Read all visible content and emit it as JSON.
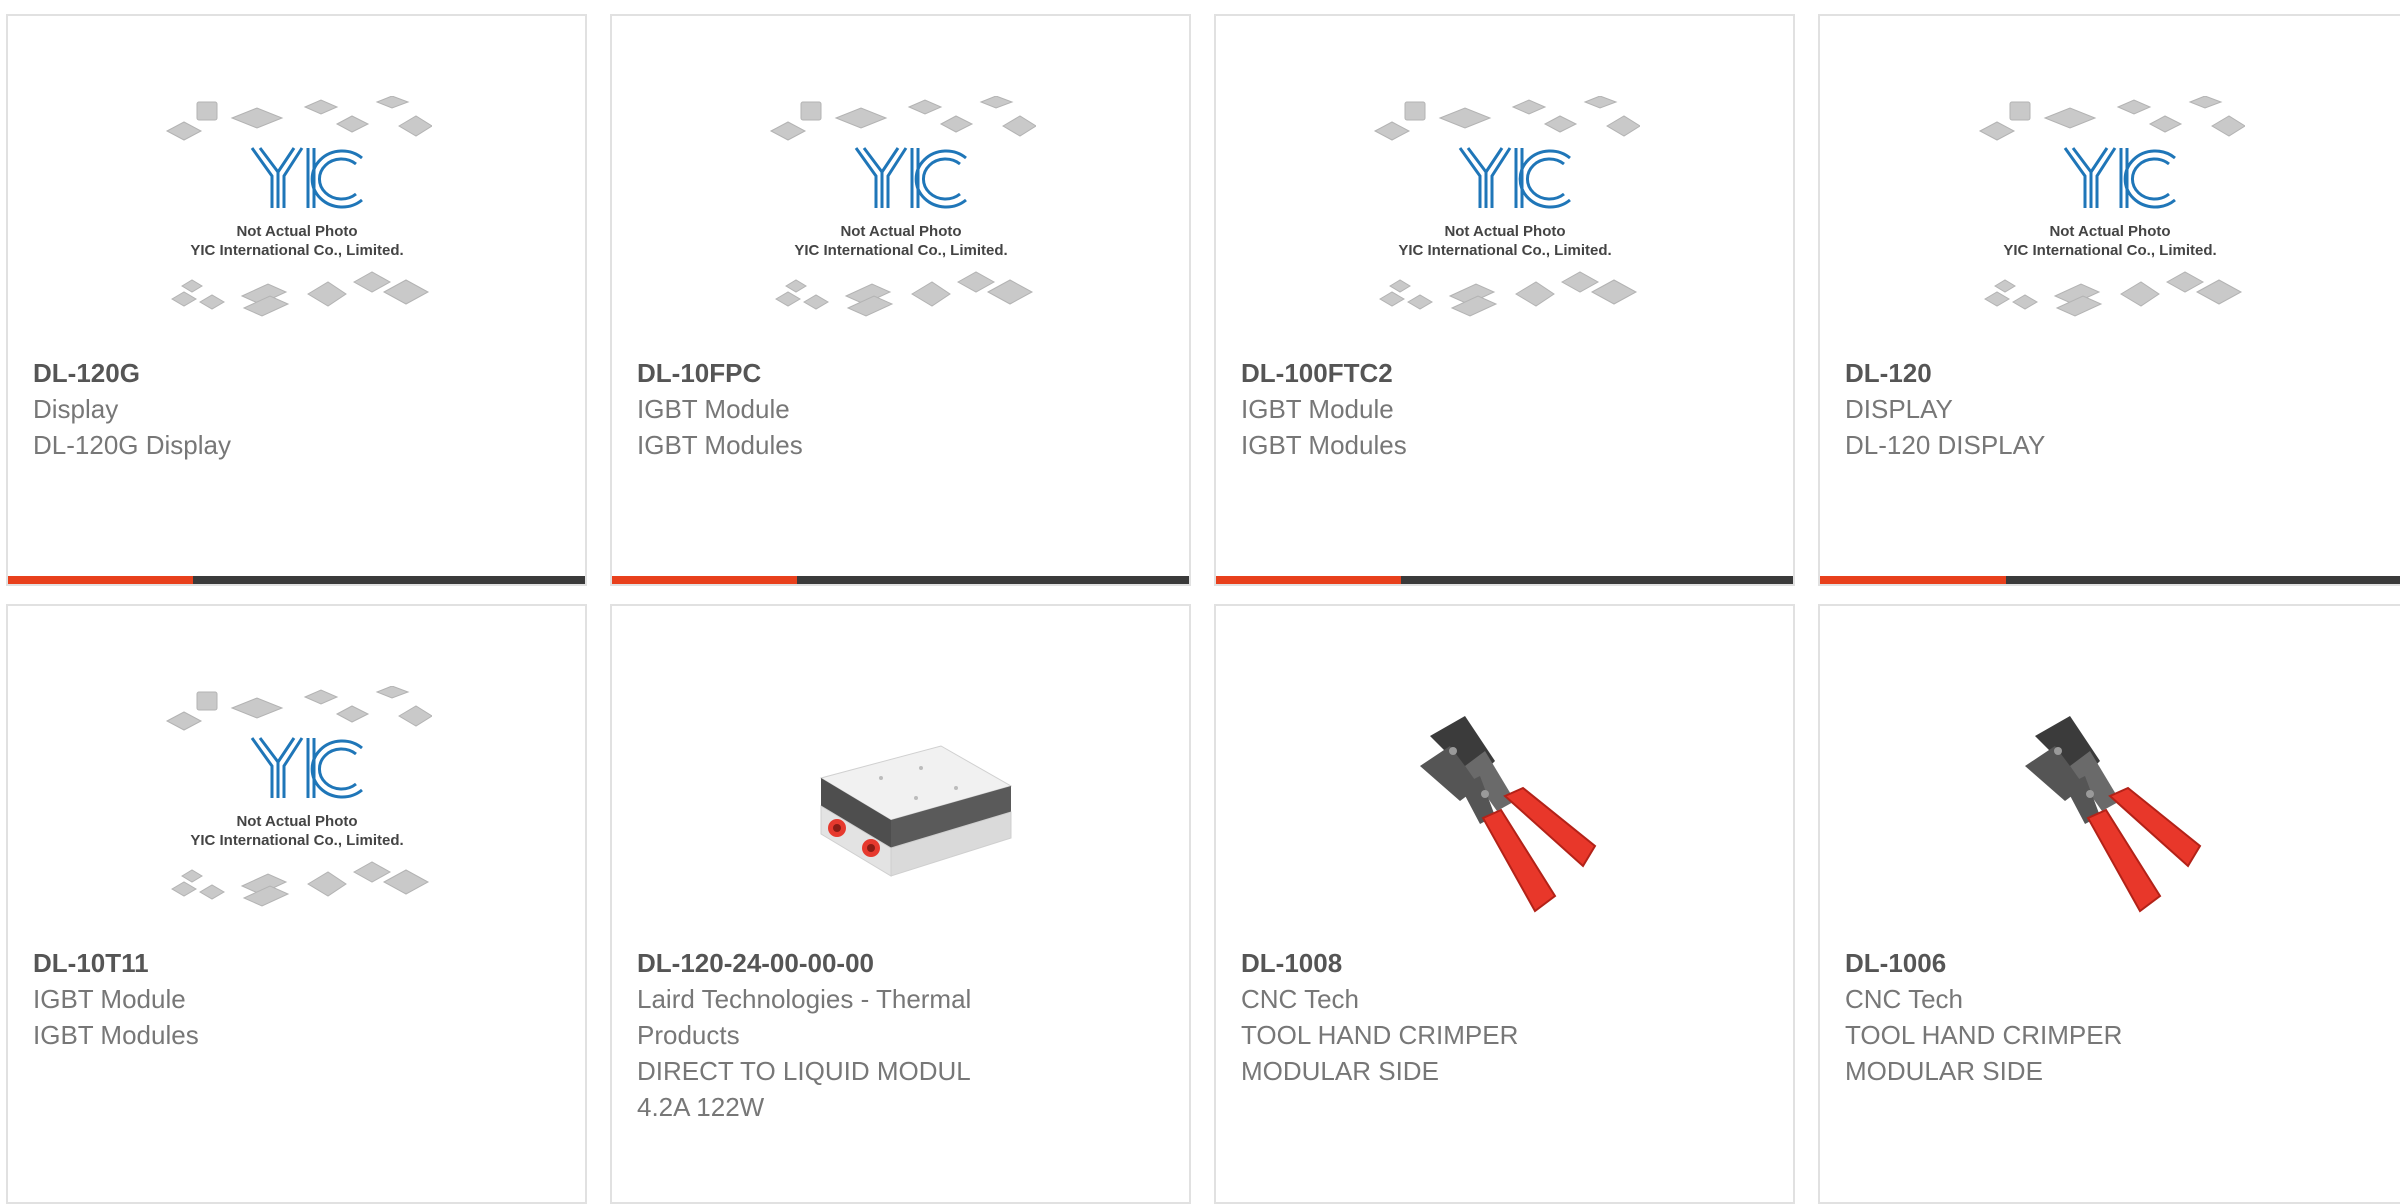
{
  "colors": {
    "accent": "#e8401c",
    "bar": "#3a3a3a",
    "border": "#e1e1e1",
    "text": "#777777",
    "title": "#555555"
  },
  "placeholder": {
    "brand": "YIC",
    "line1": "Not Actual Photo",
    "line2": "YIC International Co., Limited."
  },
  "products": [
    {
      "part": "DL-120G",
      "lines": [
        "Display",
        "DL-120G Display"
      ],
      "image": "yic-placeholder",
      "progress": 0.32
    },
    {
      "part": "DL-10FPC",
      "lines": [
        "IGBT Module",
        "IGBT Modules"
      ],
      "image": "yic-placeholder",
      "progress": 0.32
    },
    {
      "part": "DL-100FTC2",
      "lines": [
        "IGBT Module",
        "IGBT Modules"
      ],
      "image": "yic-placeholder",
      "progress": 0.32
    },
    {
      "part": "DL-120",
      "lines": [
        "DISPLAY",
        "DL-120 DISPLAY"
      ],
      "image": "yic-placeholder",
      "progress": 0.32
    },
    {
      "part": "DL-10T11",
      "lines": [
        "IGBT Module",
        "IGBT Modules"
      ],
      "image": "yic-placeholder"
    },
    {
      "part": "DL-120-24-00-00-00",
      "lines": [
        "Laird Technologies - Thermal",
        "Products",
        "DIRECT TO LIQUID MODUL",
        "4.2A 122W"
      ],
      "image": "thermal-module"
    },
    {
      "part": "DL-1008",
      "lines": [
        "CNC Tech",
        "TOOL HAND CRIMPER",
        "MODULAR SIDE"
      ],
      "image": "hand-crimper"
    },
    {
      "part": "DL-1006",
      "lines": [
        "CNC Tech",
        "TOOL HAND CRIMPER",
        "MODULAR SIDE"
      ],
      "image": "hand-crimper"
    }
  ]
}
